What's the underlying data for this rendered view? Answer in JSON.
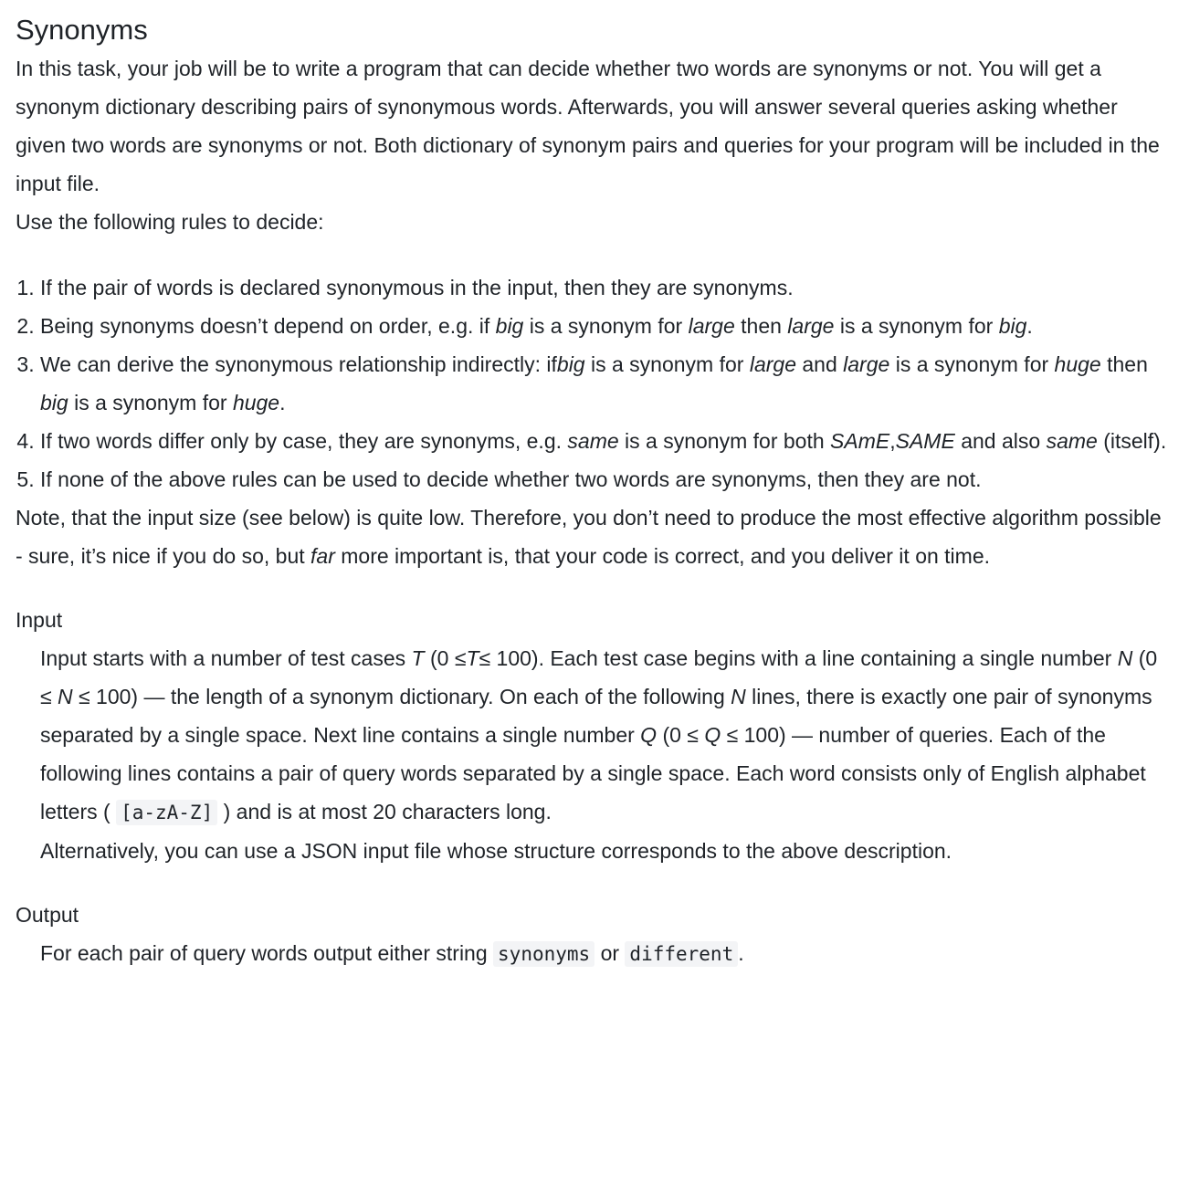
{
  "title": "Synonyms",
  "intro": "In this task, your job will be to write a program that can decide whether two words are synonyms or not. You will get a synonym dictionary describing pairs of synonymous words. Afterwards, you will answer several queries asking whether given two words are synonyms or not. Both dictionary of synonym pairs and queries for your program will be included in the input file.",
  "rules_lead": "Use the following rules to decide:",
  "rules": {
    "r1": "If the pair of words is declared synonymous in the input, then they are synonyms.",
    "r2": {
      "t1": "Being synonyms doesn’t depend on order, e.g. if ",
      "e1": "big",
      "t2": " is a synonym for ",
      "e2": "large",
      "t3": " then ",
      "e3": "large",
      "t4": " is a synonym for ",
      "e4": "big",
      "t5": "."
    },
    "r3": {
      "t1": "We can derive the synonymous relationship indirectly: if",
      "e1": "big",
      "t2": " is a synonym for ",
      "e2": "large",
      "t3": " and ",
      "e3": "large",
      "t4": " is a synonym for ",
      "e4": "huge",
      "t5": " then ",
      "e5": "big",
      "t6": " is a synonym for ",
      "e6": "huge",
      "t7": "."
    },
    "r4": {
      "t1": "If two words differ only by case, they are synonyms, e.g. ",
      "e1": "same",
      "t2": " is a synonym for both ",
      "e2": "SAmE",
      "t3": ",",
      "e3": "SAME",
      "t4": " and also ",
      "e4": "same",
      "t5": " (itself)."
    },
    "r5": "If none of the above rules can be used to decide whether two words are synonyms, then they are not."
  },
  "note": {
    "t1": "Note, that the input size (see below) is quite low. Therefore, you don’t need to produce the most effective algorithm possible - sure, it’s nice if you do so, but ",
    "e1": "far",
    "t2": " more important is, that your code is correct, and you deliver it on time."
  },
  "input_section": {
    "heading": "Input",
    "t1": "Input starts with a number of test cases ",
    "v1": "T",
    "t2": " (0 ≤",
    "v2": "T",
    "t3": "≤ 100). Each test case begins with a line containing a single number ",
    "v3": "N",
    "t4": " (0 ≤ ",
    "v4": "N",
    "t5": " ≤ 100) — the length of a synonym dictionary. On each of the following ",
    "v5": "N",
    "t6": " lines, there is exactly one pair of synonyms separated by a single space. Next line contains a single number ",
    "v6": "Q",
    "t7": " (0 ≤ ",
    "v7": "Q",
    "t8": " ≤ 100) — number of queries. Each of the following lines contains a pair of query words separated by a single space. Each word consists only of English alphabet letters ( ",
    "code": "[a-zA-Z]",
    "t9": " ) and is at most 20 characters long.",
    "alt": "Alternatively, you can use a JSON input file whose structure corresponds to the above description."
  },
  "output_section": {
    "heading": "Output",
    "t1": "For each pair of query words output either string ",
    "c1": "synonyms",
    "t2": " or ",
    "c2": "different",
    "t3": "."
  }
}
